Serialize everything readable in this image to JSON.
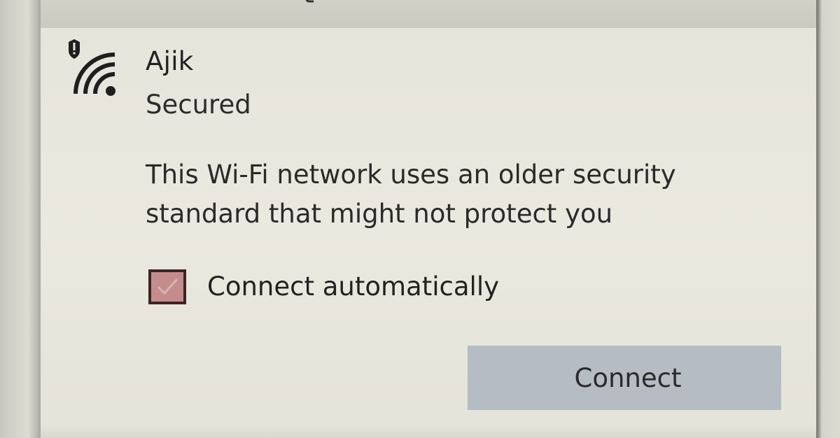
{
  "network": {
    "name": "Ajik",
    "status": "Secured",
    "icon": "wifi-secured-warning-icon"
  },
  "warning": {
    "text": "This Wi-Fi network uses an older security standard that might not protect you"
  },
  "auto_connect": {
    "label": "Connect automatically",
    "checked": true
  },
  "actions": {
    "connect_label": "Connect"
  },
  "colors": {
    "panel_background": "#e8e7dd",
    "button_background": "#b5bcc3",
    "checkbox_fill": "#c48d8b"
  }
}
